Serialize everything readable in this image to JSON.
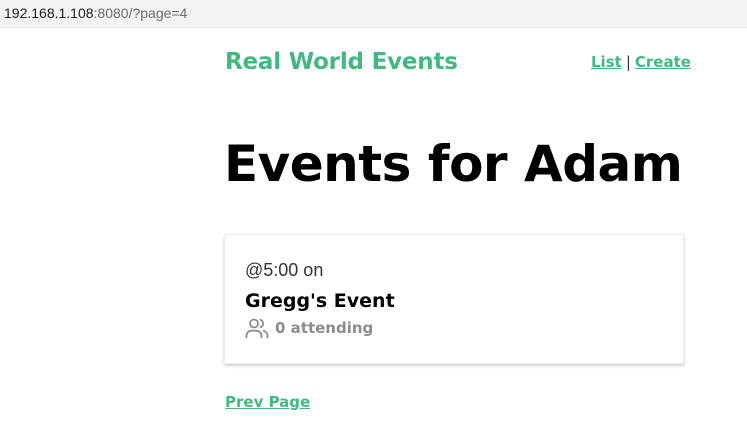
{
  "browser": {
    "url_host": "192.168.1.108",
    "url_rest": ":8080/?page=4"
  },
  "header": {
    "brand": "Real World Events",
    "nav": {
      "list_label": "List",
      "separator": "|",
      "create_label": "Create"
    }
  },
  "main": {
    "title": "Events for Adam",
    "events": [
      {
        "time": "@5:00 on",
        "title": "Gregg's Event",
        "attending": "0 attending",
        "icon": "users-icon"
      }
    ],
    "pagination": {
      "prev_label": "Prev Page"
    }
  },
  "colors": {
    "accent": "#42b983",
    "muted": "#8c8c8c"
  }
}
